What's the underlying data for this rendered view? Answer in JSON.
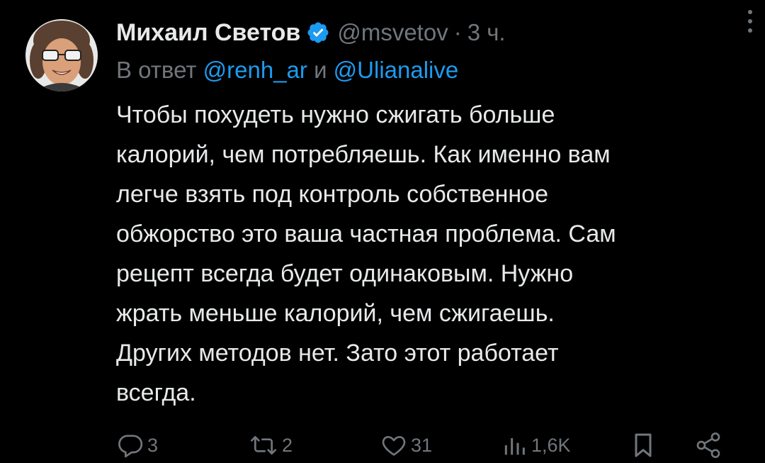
{
  "tweet": {
    "display_name": "Михаил Светов",
    "handle": "@msvetov",
    "separator": "·",
    "time": "3 ч.",
    "reply_prefix": "В ответ",
    "reply_mentions": [
      "@renh_ar",
      "@Ulianalive"
    ],
    "reply_conjunction": "и",
    "text": "Чтобы похудеть нужно сжигать больше\nкалорий, чем потребляешь. Как именно вам\nлегче взять под контроль собственное\nобжорство это ваша частная проблема. Сам\nрецепт всегда будет одинаковым. Нужно\nжрать меньше калорий, чем сжигаешь.\nДругих методов нет. Зато этот работает\nвсегда."
  },
  "actions": {
    "replies": "3",
    "reposts": "2",
    "likes": "31",
    "views": "1,6K"
  },
  "icons": {
    "verified": "verified-badge-icon",
    "more": "more-vertical-icon",
    "reply": "reply-icon",
    "repost": "repost-icon",
    "like": "heart-icon",
    "views": "views-bar-chart-icon",
    "bookmark": "bookmark-icon",
    "share": "share-icon"
  },
  "colors": {
    "background": "#000000",
    "text": "#e7e9ea",
    "secondary": "#71767b",
    "accent": "#1d9bf0"
  }
}
